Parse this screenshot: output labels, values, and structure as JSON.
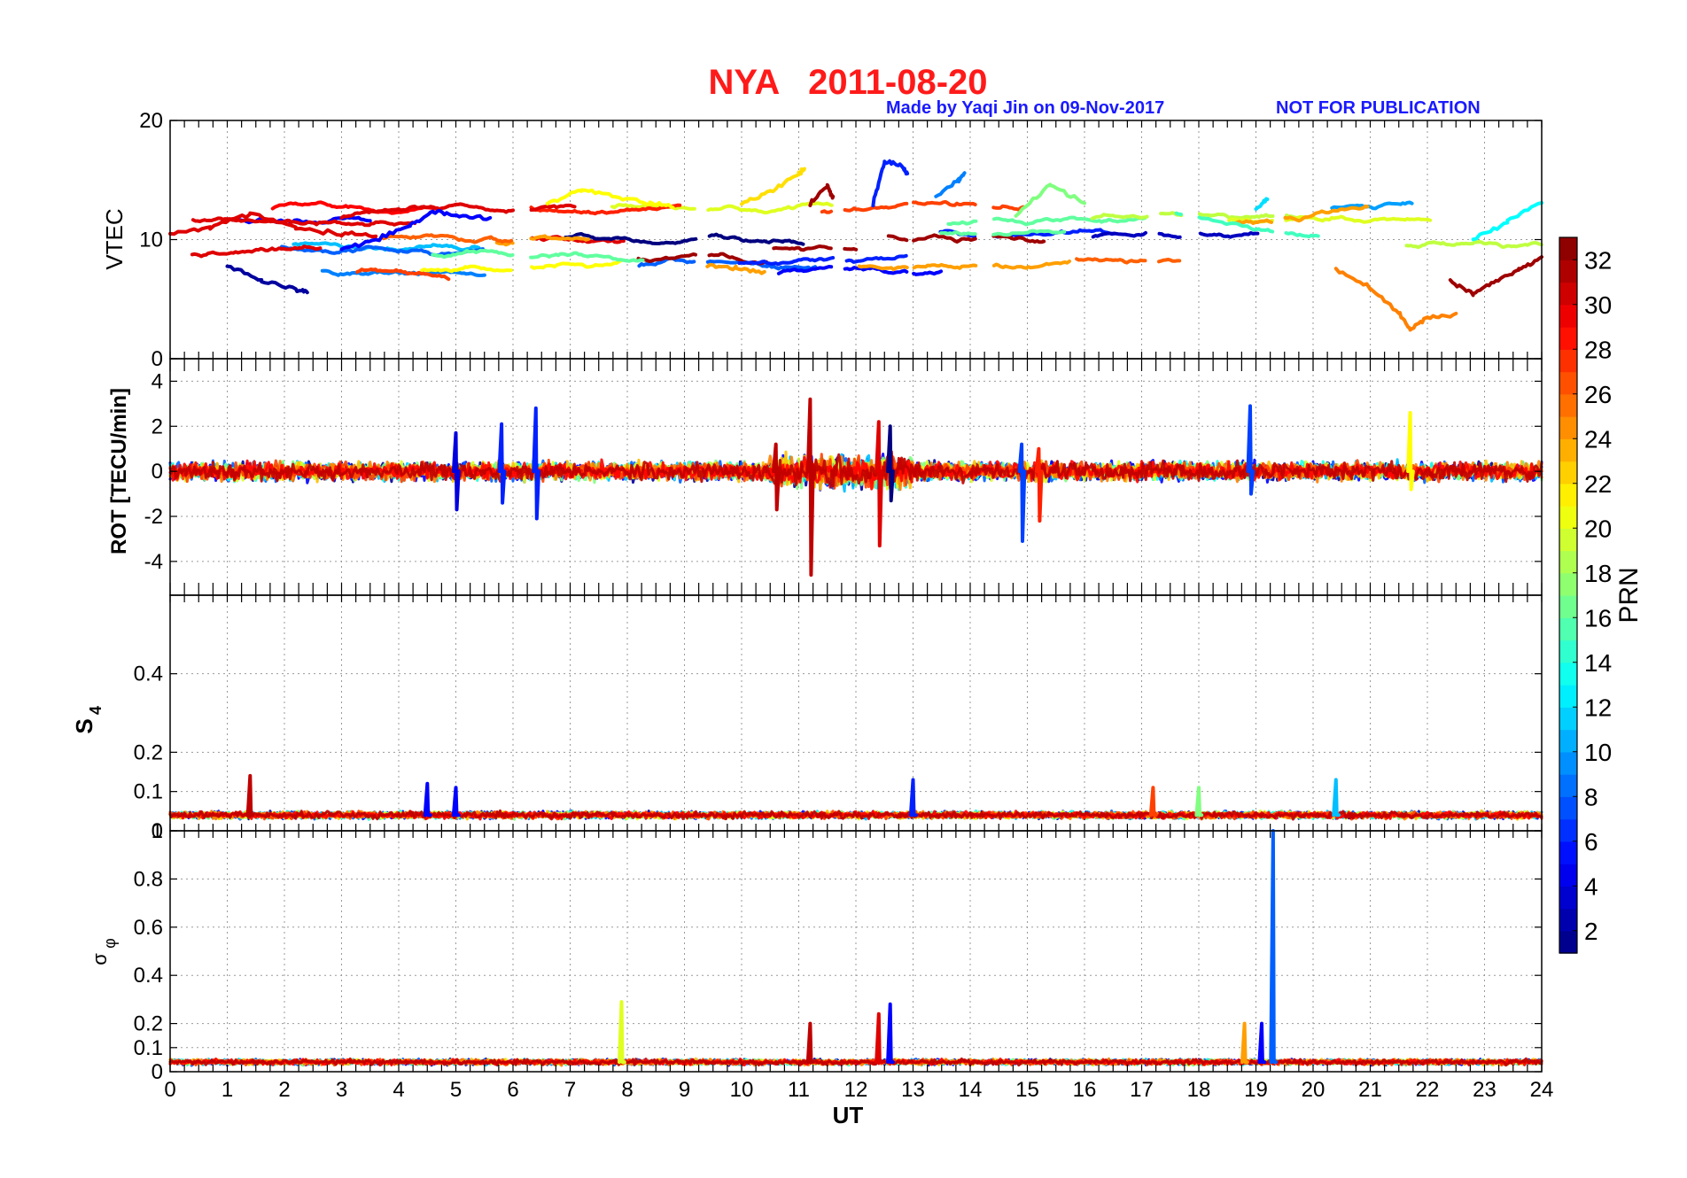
{
  "figure": {
    "title": "NYA   2011-08-20",
    "credit": "Made by Yaqi Jin on 09-Nov-2017",
    "notice": "NOT FOR PUBLICATION",
    "title_color": "#ff1a1a",
    "note_color": "#1a1aff"
  },
  "chart_data": [
    {
      "type": "line",
      "panel": "VTEC",
      "ylabel": "VTEC",
      "xlabel": "",
      "xlim": [
        0,
        24
      ],
      "ylim": [
        0,
        20
      ],
      "yticks": [
        0,
        10,
        20
      ],
      "grid": true,
      "coverage_gaps_hours": [
        [
          6.0,
          6.3
        ],
        [
          9.2,
          9.4
        ],
        [
          11.6,
          11.8
        ],
        [
          12.9,
          13.0
        ],
        [
          14.1,
          14.4
        ],
        [
          17.1,
          17.3
        ],
        [
          17.7,
          18.0
        ],
        [
          19.3,
          19.5
        ]
      ],
      "series": [
        {
          "prn": 2,
          "values_x": [
            1.0,
            1.6,
            2.2,
            2.4
          ],
          "values_y": [
            7.8,
            6.5,
            5.8,
            5.6
          ]
        },
        {
          "prn": 5,
          "values_x": [
            3.0,
            3.6,
            4.2,
            4.6,
            5.0,
            5.6
          ],
          "values_y": [
            9.2,
            10.0,
            11.2,
            12.4,
            12.0,
            11.8
          ]
        },
        {
          "prn": 6,
          "values_x": [
            12.3,
            12.5,
            12.8,
            12.9
          ],
          "values_y": [
            13.0,
            16.5,
            16.2,
            15.5
          ]
        },
        {
          "prn": 9,
          "values_x": [
            13.4,
            13.8,
            13.9
          ],
          "values_y": [
            13.5,
            15.0,
            15.5
          ]
        },
        {
          "prn": 12,
          "values_x": [
            19.0,
            19.2
          ],
          "values_y": [
            12.6,
            13.4
          ]
        },
        {
          "prn": 13,
          "values_x": [
            22.8,
            23.4,
            24.0
          ],
          "values_y": [
            10.0,
            11.5,
            13.2
          ]
        },
        {
          "prn": 17,
          "values_x": [
            14.8,
            15.4,
            16.0
          ],
          "values_y": [
            12.0,
            14.6,
            13.0
          ]
        },
        {
          "prn": 21,
          "values_x": [
            6.6,
            7.2,
            7.8,
            8.4,
            8.8
          ],
          "values_y": [
            13.0,
            14.2,
            13.6,
            13.0,
            12.8
          ]
        },
        {
          "prn": 22,
          "values_x": [
            10.0,
            10.5,
            11.0,
            11.1
          ],
          "values_y": [
            13.0,
            14.0,
            15.5,
            16.0
          ]
        },
        {
          "prn": 24,
          "values_x": [
            9.4,
            9.9,
            10.4
          ],
          "values_y": [
            7.8,
            7.6,
            7.3
          ]
        },
        {
          "prn": 25,
          "values_x": [
            20.4,
            21.0,
            21.5,
            21.7,
            22.0,
            22.5
          ],
          "values_y": [
            7.5,
            6.0,
            3.8,
            2.5,
            3.5,
            3.6
          ]
        },
        {
          "prn": 30,
          "values_x": [
            0.0,
            0.7,
            1.4,
            2.2,
            3.0,
            3.6
          ],
          "values_y": [
            10.5,
            11.0,
            12.2,
            11.0,
            10.5,
            10.3
          ]
        },
        {
          "prn": 32,
          "values_x": [
            11.2,
            11.5,
            11.6
          ],
          "values_y": [
            13.0,
            14.5,
            13.5
          ]
        },
        {
          "prn": 32,
          "values_x": [
            22.4,
            22.8,
            23.2,
            23.6,
            24.0
          ],
          "values_y": [
            6.5,
            5.5,
            6.5,
            7.5,
            8.4
          ]
        }
      ]
    },
    {
      "type": "line",
      "panel": "ROT",
      "ylabel": "ROT [TECU/min]",
      "xlabel": "",
      "xlim": [
        0,
        24
      ],
      "ylim": [
        -5.5,
        5
      ],
      "yticks": [
        -4,
        -2,
        0,
        2,
        4
      ],
      "grid": true,
      "spikes": [
        {
          "prn": 31,
          "x": 11.2,
          "min": -4.6,
          "max": 3.2
        },
        {
          "prn": 30,
          "x": 12.4,
          "min": -3.3,
          "max": 2.2
        },
        {
          "prn": 6,
          "x": 6.4,
          "min": -2.1,
          "max": 2.8
        },
        {
          "prn": 7,
          "x": 14.9,
          "min": -3.1,
          "max": 1.2
        },
        {
          "prn": 7,
          "x": 18.9,
          "min": -1.0,
          "max": 2.9
        },
        {
          "prn": 21,
          "x": 21.7,
          "min": -0.8,
          "max": 2.6
        },
        {
          "prn": 4,
          "x": 5.0,
          "min": -1.7,
          "max": 1.7
        },
        {
          "prn": 6,
          "x": 5.8,
          "min": -1.4,
          "max": 2.1
        },
        {
          "prn": 28,
          "x": 15.2,
          "min": -2.2,
          "max": 1.0
        },
        {
          "prn": 31,
          "x": 10.6,
          "min": -1.7,
          "max": 1.2
        },
        {
          "prn": 1,
          "x": 12.6,
          "min": -1.3,
          "max": 2.0
        }
      ]
    },
    {
      "type": "line",
      "panel": "S4",
      "ylabel": "S4",
      "xlabel": "",
      "xlim": [
        0,
        24
      ],
      "ylim": [
        0,
        0.6
      ],
      "yticks": [
        0,
        0.1,
        0.2,
        0.4
      ],
      "grid": true,
      "spikes": [
        {
          "prn": 31,
          "x": 1.4,
          "max": 0.14
        },
        {
          "prn": 5,
          "x": 4.5,
          "max": 0.12
        },
        {
          "prn": 5,
          "x": 5.0,
          "max": 0.11
        },
        {
          "prn": 6,
          "x": 13.0,
          "max": 0.13
        },
        {
          "prn": 27,
          "x": 17.2,
          "max": 0.11
        },
        {
          "prn": 11,
          "x": 20.4,
          "max": 0.13
        },
        {
          "prn": 17,
          "x": 18.0,
          "max": 0.11
        }
      ]
    },
    {
      "type": "line",
      "panel": "sigma_phi",
      "ylabel": "σφ",
      "xlabel": "UT",
      "xlim": [
        0,
        24
      ],
      "ylim": [
        0,
        1
      ],
      "yticks": [
        0,
        0.1,
        0.2,
        0.4,
        0.6,
        0.8,
        1
      ],
      "grid": true,
      "spikes": [
        {
          "prn": 8,
          "x": 19.3,
          "max": 1.0
        },
        {
          "prn": 20,
          "x": 7.9,
          "max": 0.29
        },
        {
          "prn": 5,
          "x": 12.6,
          "max": 0.28
        },
        {
          "prn": 30,
          "x": 12.4,
          "max": 0.24
        },
        {
          "prn": 31,
          "x": 11.2,
          "max": 0.2
        },
        {
          "prn": 24,
          "x": 18.8,
          "max": 0.2
        },
        {
          "prn": 5,
          "x": 19.1,
          "max": 0.2
        }
      ]
    }
  ],
  "axes": {
    "xlabel": "UT",
    "xticks": [
      0,
      1,
      2,
      3,
      4,
      5,
      6,
      7,
      8,
      9,
      10,
      11,
      12,
      13,
      14,
      15,
      16,
      17,
      18,
      19,
      20,
      21,
      22,
      23,
      24
    ],
    "vtec_ticks": [
      "0",
      "10",
      "20"
    ],
    "rot_ticks": [
      "-4",
      "-2",
      "0",
      "2",
      "4"
    ],
    "s4_ticks": [
      "0",
      "0.1",
      "0.2",
      "0.4"
    ],
    "sig_ticks": [
      "0",
      "0.1",
      "0.2",
      "0.4",
      "0.6",
      "0.8",
      "1"
    ],
    "vtec_label": "VTEC",
    "rot_label": "ROT [TECU/min]",
    "s4_label_main": "S",
    "s4_label_sub": "4",
    "sig_label_main": "σ",
    "sig_label_sub": "φ"
  },
  "colorbar": {
    "label": "PRN",
    "range": [
      1,
      33
    ],
    "ticks": [
      "2",
      "4",
      "6",
      "8",
      "10",
      "12",
      "14",
      "16",
      "18",
      "20",
      "22",
      "24",
      "26",
      "28",
      "30",
      "32"
    ],
    "colormap": "jet"
  }
}
